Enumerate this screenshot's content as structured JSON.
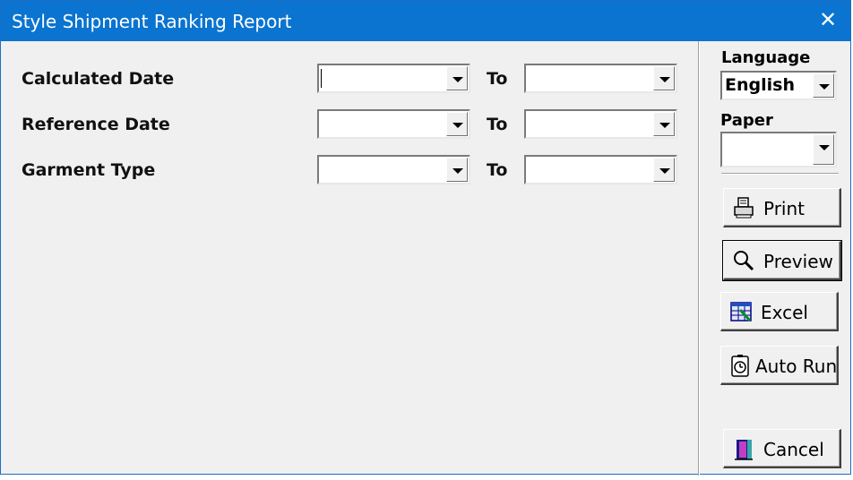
{
  "window": {
    "title": "Style Shipment Ranking Report",
    "close_glyph": "✕"
  },
  "filters": [
    {
      "label": "Calculated Date",
      "from_value": "",
      "to_label": "To",
      "to_value": ""
    },
    {
      "label": "Reference Date",
      "from_value": "",
      "to_label": "To",
      "to_value": ""
    },
    {
      "label": "Garment Type",
      "from_value": "",
      "to_label": "To",
      "to_value": ""
    }
  ],
  "sidebar": {
    "language_label": "Language",
    "language_value": "English",
    "paper_label": "Paper",
    "paper_value": "",
    "buttons": {
      "print": "Print",
      "preview": "Preview",
      "excel": "Excel",
      "auto_run": "Auto Run",
      "cancel": "Cancel"
    }
  },
  "icons": {
    "print": "printer-icon",
    "preview": "magnifier-icon",
    "excel": "spreadsheet-icon",
    "auto_run": "stopwatch-icon",
    "cancel": "exit-door-icon"
  },
  "colors": {
    "titlebar": "#0a74d0",
    "background": "#f0f0f0"
  }
}
